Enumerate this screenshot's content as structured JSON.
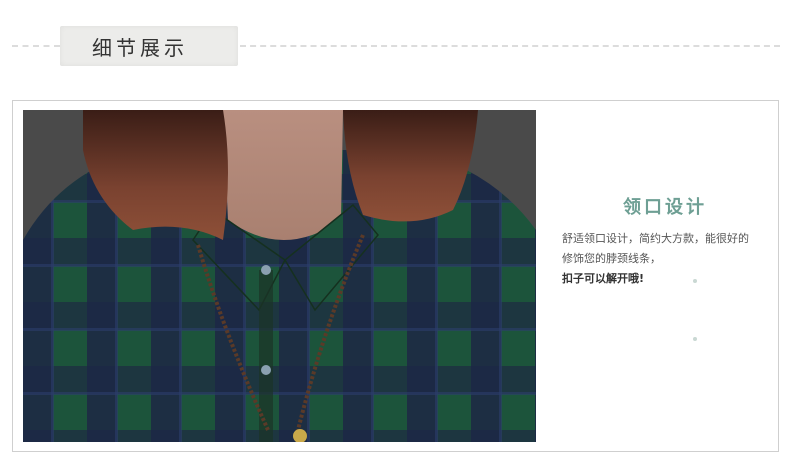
{
  "header": {
    "title": "细节展示"
  },
  "feature": {
    "title": "领口设计",
    "desc_line1": "舒适领口设计，简约大方款，能很好的",
    "desc_line2": "修饰您的脖颈线条，",
    "strong": "扣子可以解开哦!"
  },
  "colors": {
    "accent": "#6e9f94",
    "plaid_green": "#1f4b38",
    "plaid_navy": "#1c2447",
    "hair": "#6b3a2b"
  },
  "photo": {
    "subject": "plaid-shirt-collar-with-necklace"
  }
}
